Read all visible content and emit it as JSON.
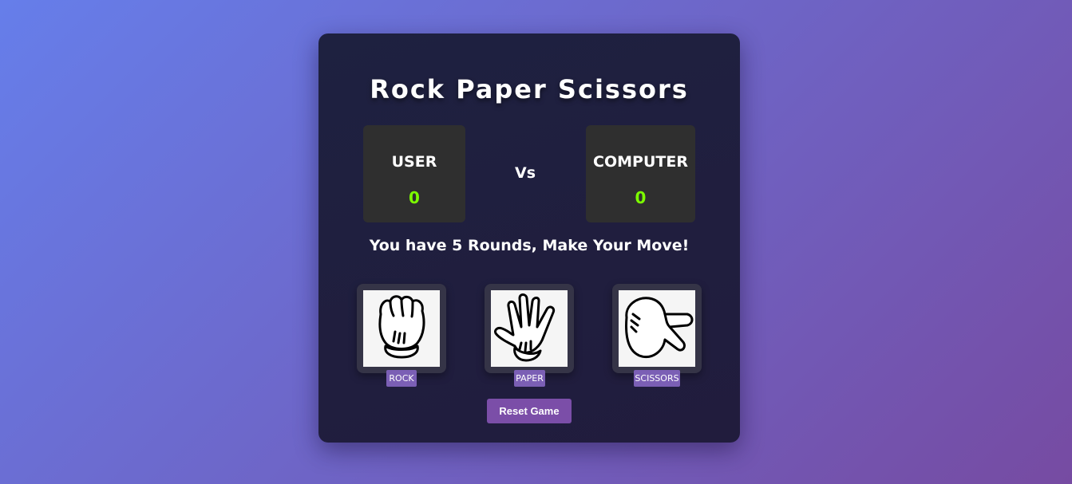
{
  "game": {
    "title": "Rock Paper Scissors",
    "vs_label": "Vs",
    "message": "You have 5 Rounds, Make Your Move!",
    "reset_label": "Reset Game"
  },
  "scores": {
    "user": {
      "label": "USER",
      "value": "0"
    },
    "computer": {
      "label": "COMPUTER",
      "value": "0"
    }
  },
  "choices": [
    {
      "label": "ROCK",
      "icon": "rock-hand-icon"
    },
    {
      "label": "PAPER",
      "icon": "paper-hand-icon"
    },
    {
      "label": "SCISSORS",
      "icon": "scissors-hand-icon"
    }
  ],
  "colors": {
    "score_value": "#7cfc00",
    "accent": "#7b4ea8",
    "label_bg": "#7b5fb5"
  }
}
